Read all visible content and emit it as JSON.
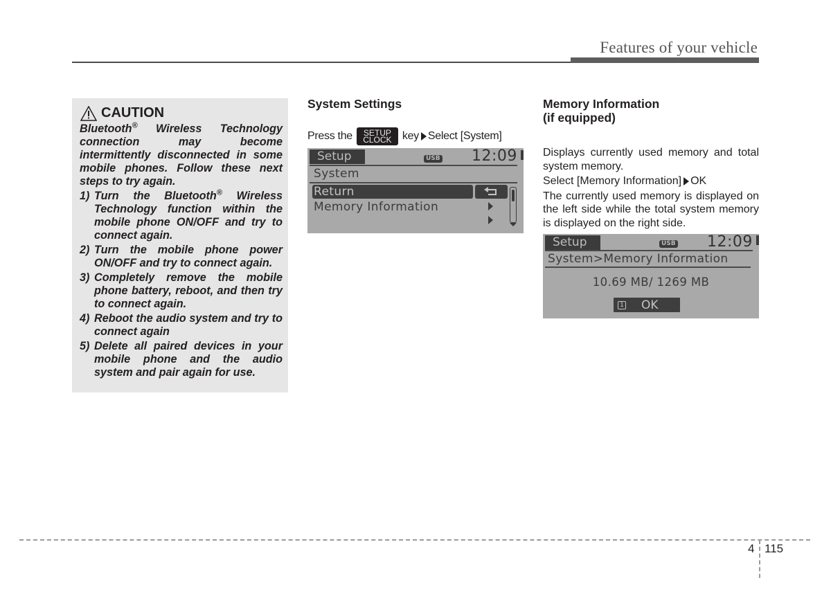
{
  "header": {
    "section_title": "Features of your vehicle"
  },
  "caution": {
    "icon": "warning-triangle-icon",
    "title": "CAUTION",
    "intro_pre": "Bluetooth",
    "intro_sup": "®",
    "intro_post": " Wireless Technology connection may become intermittently disconnected in some mobile phones. Follow these next steps to try again.",
    "steps": [
      {
        "num": "1)",
        "pre": "Turn the Bluetooth",
        "sup": "®",
        "post": " Wireless Technology function within the mobile phone ON/OFF and try to connect again."
      },
      {
        "num": "2)",
        "text": "Turn the mobile phone power ON/OFF and try to connect again."
      },
      {
        "num": "3)",
        "text": "Completely remove the mobile phone battery, reboot, and then try to connect again."
      },
      {
        "num": "4)",
        "text": "Reboot the audio system and try to connect again"
      },
      {
        "num": "5)",
        "text": "Delete all paired devices in your mobile phone and the audio system and pair again for use."
      }
    ]
  },
  "system_settings": {
    "title": "System Settings",
    "press_the": "Press the",
    "key_top": "SETUP",
    "key_bottom": "CLOCK",
    "key_word": "key",
    "select_text": "Select [System]",
    "screen": {
      "tab": "Setup",
      "usb_badge": "USB",
      "clock": "12:09",
      "heading": "System",
      "items": [
        {
          "label": "Return",
          "selected": true,
          "icon": "return-arrow-icon"
        },
        {
          "label": "Memory Information",
          "selected": false,
          "icon": "chevron-right-icon"
        },
        {
          "label": "",
          "selected": false,
          "icon": "chevron-right-icon"
        }
      ],
      "scroll_icon": "scrollbar"
    }
  },
  "memory_info": {
    "title_line1": "Memory Information",
    "title_line2": "(if equipped)",
    "desc": "Displays currently used memory and total system memory.",
    "select_pre": "Select [Memory Information]",
    "select_post": "OK",
    "detail": "The currently used memory is displayed on the left side while the total system memory is displayed on the right side.",
    "screen": {
      "tab": "Setup",
      "usb_badge": "USB",
      "clock": "12:09",
      "breadcrumb": "System>Memory Information",
      "memory_value": "10.69 MB/ 1269 MB",
      "ok_key": "1",
      "ok_label": "OK"
    }
  },
  "footer": {
    "chapter": "4",
    "page": "115"
  }
}
